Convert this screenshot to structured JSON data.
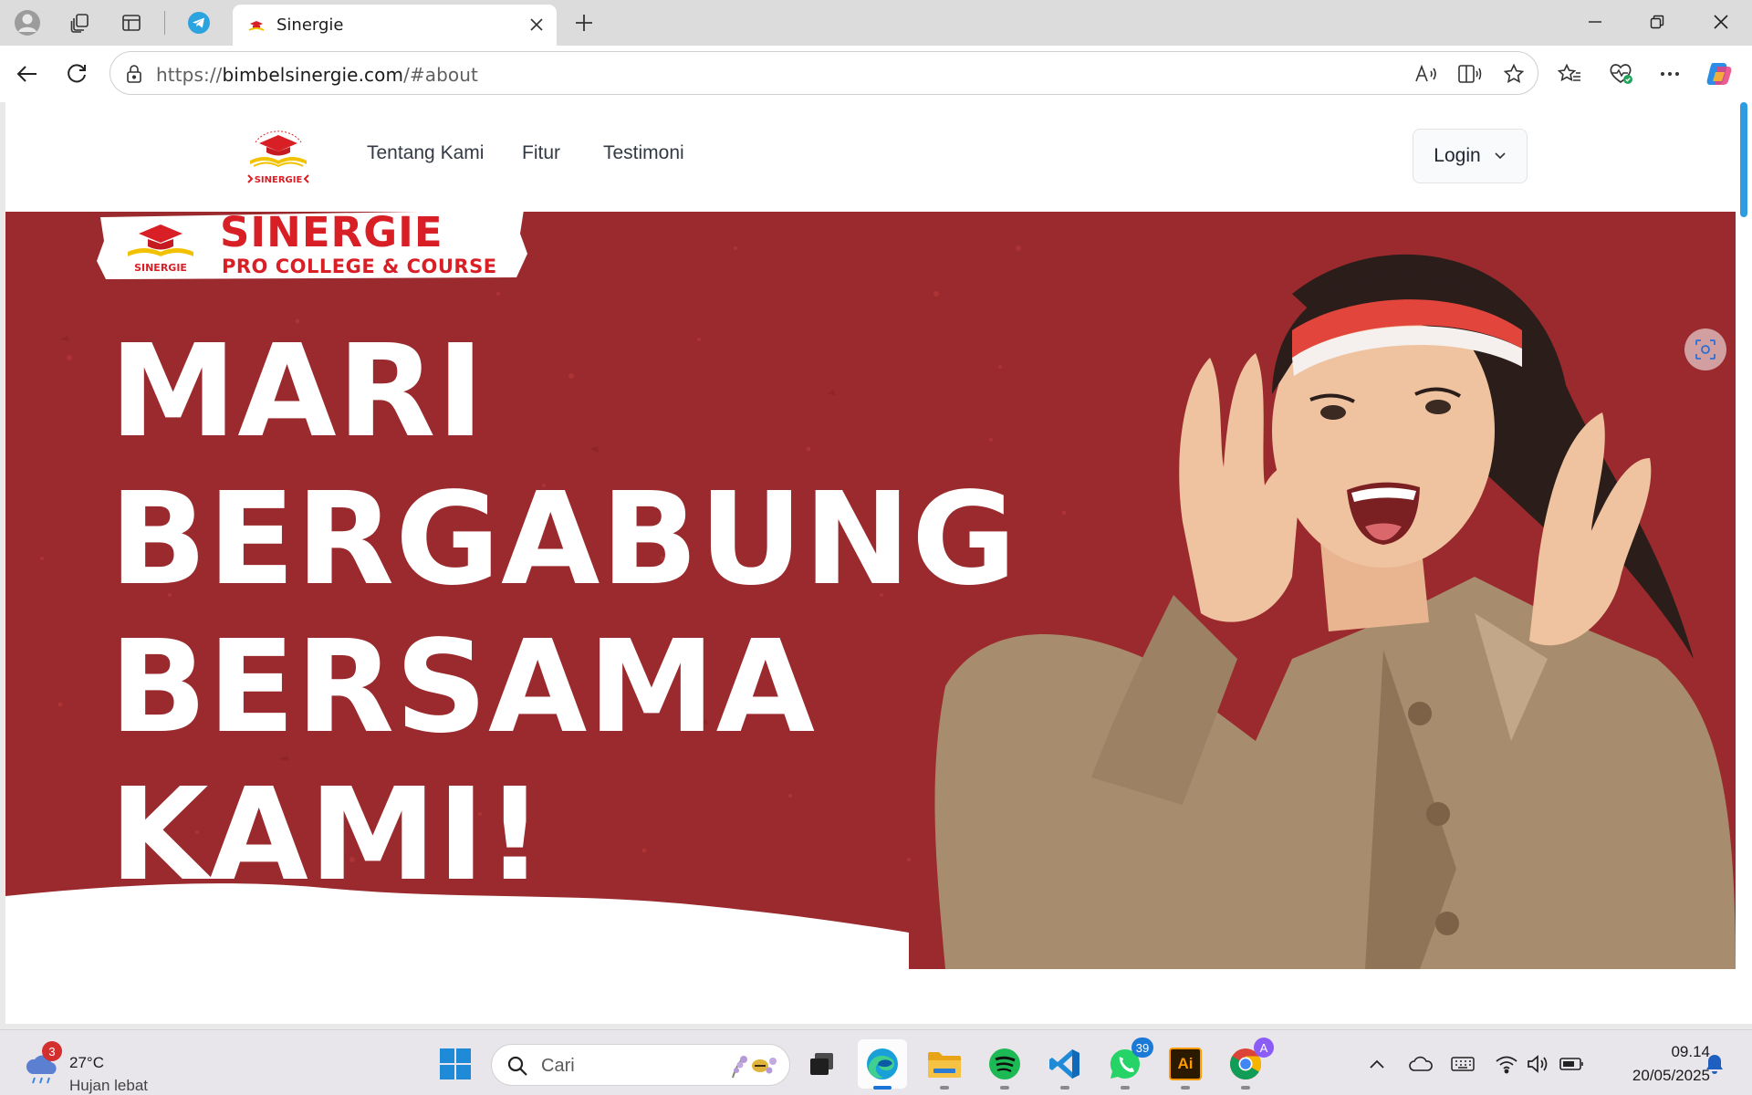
{
  "browser": {
    "tab": {
      "title": "Sinergie",
      "close_icon": "close-icon"
    },
    "address": {
      "scheme": "https://",
      "host": "bimbelsinergie.com",
      "path": "/#about"
    }
  },
  "site": {
    "nav": [
      {
        "label": "Tentang Kami"
      },
      {
        "label": "Fitur"
      },
      {
        "label": "Testimoni"
      }
    ],
    "login_label": "Login",
    "logo_caption": "SINERGIE",
    "logo_arc": "PRO COLLEGE & COURSE"
  },
  "hero": {
    "brand": "SINERGIE",
    "brand_sub": "PRO COLLEGE & COURSE",
    "brand_small": "SINERGIE",
    "lines": [
      "MARI",
      "BERGABUNG",
      "BERSAMA",
      "KAMI!"
    ],
    "colors": {
      "background": "#9a2a2d",
      "brand_red": "#d81f26",
      "headband_red": "#e2453b"
    }
  },
  "taskbar": {
    "weather": {
      "temp": "27°C",
      "desc": "Hujan lebat",
      "badge": "3"
    },
    "search_placeholder": "Cari",
    "whatsapp_badge": "39",
    "chrome_badge": "A",
    "illustrator_label": "Ai",
    "time": "09.14",
    "date": "20/05/2025"
  }
}
